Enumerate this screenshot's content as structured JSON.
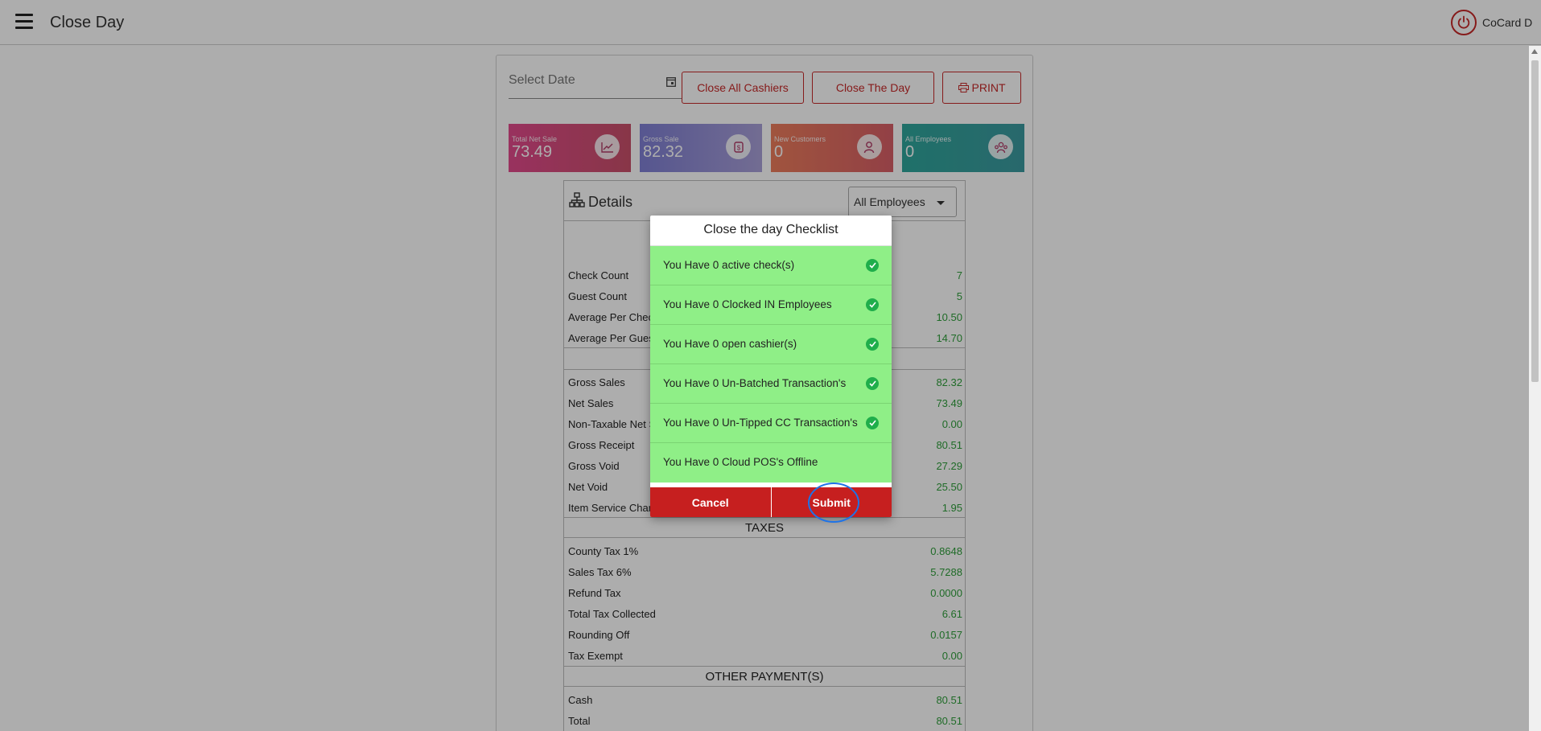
{
  "header": {
    "title": "Close Day",
    "user_name": "CoCard D"
  },
  "toolbar": {
    "date_placeholder": "Select Date",
    "close_all_cashiers": "Close All Cashiers",
    "close_the_day": "Close The Day",
    "print": "PRINT"
  },
  "stats": [
    {
      "label": "Total Net Sale",
      "value": "73.49",
      "color": "#d84a7f",
      "icon": "line-chart-icon"
    },
    {
      "label": "Gross Sale",
      "value": "82.32",
      "color": "#8a8fd6",
      "icon": "money-exchange-icon"
    },
    {
      "label": "New Customers",
      "value": "0",
      "color": "#e8735a",
      "icon": "user-add-icon"
    },
    {
      "label": "All Employees",
      "value": "0",
      "color": "#2aa39c",
      "icon": "team-icon"
    }
  ],
  "details": {
    "title": "Details",
    "employee_filter": "All Employees",
    "summary": [
      {
        "label": "Check Count",
        "value": "7"
      },
      {
        "label": "Guest Count",
        "value": "5"
      },
      {
        "label": "Average Per Check",
        "value": "10.50"
      },
      {
        "label": "Average Per Guest",
        "value": "14.70"
      }
    ],
    "sales": [
      {
        "label": "Gross Sales",
        "value": "82.32"
      },
      {
        "label": "Net Sales",
        "value": "73.49"
      },
      {
        "label": "Non-Taxable Net Sales",
        "value": "0.00"
      },
      {
        "label": "Gross Receipt",
        "value": "80.51"
      },
      {
        "label": "Gross Void",
        "value": "27.29"
      },
      {
        "label": "Net Void",
        "value": "25.50"
      },
      {
        "label": "Item Service Charge",
        "value": "1.95"
      }
    ],
    "taxes_heading": "TAXES",
    "taxes": [
      {
        "label": "County Tax 1%",
        "value": "0.8648"
      },
      {
        "label": "Sales Tax 6%",
        "value": "5.7288"
      },
      {
        "label": "Refund Tax",
        "value": "0.0000"
      },
      {
        "label": "Total Tax Collected",
        "value": "6.61"
      },
      {
        "label": "Rounding Off",
        "value": "0.0157"
      },
      {
        "label": "Tax Exempt",
        "value": "0.00"
      }
    ],
    "payments_heading": "OTHER PAYMENT(S)",
    "payments": [
      {
        "label": "Cash",
        "value": "80.51"
      },
      {
        "label": "Total",
        "value": "80.51"
      }
    ]
  },
  "modal": {
    "title": "Close the day Checklist",
    "items": [
      {
        "text": "You Have 0 active check(s)",
        "ok": true
      },
      {
        "text": "You Have 0 Clocked IN Employees",
        "ok": true
      },
      {
        "text": "You Have 0 open cashier(s)",
        "ok": true
      },
      {
        "text": "You Have 0 Un-Batched Transaction's",
        "ok": true
      },
      {
        "text": "You Have 0 Un-Tipped CC Transaction's",
        "ok": true
      },
      {
        "text": "You Have 0 Cloud POS's Offline",
        "ok": false
      }
    ],
    "cancel_label": "Cancel",
    "submit_label": "Submit"
  },
  "colors": {
    "accent": "#c62828",
    "checklist_bg": "#8fef87",
    "value_green": "#2e9e3a"
  }
}
